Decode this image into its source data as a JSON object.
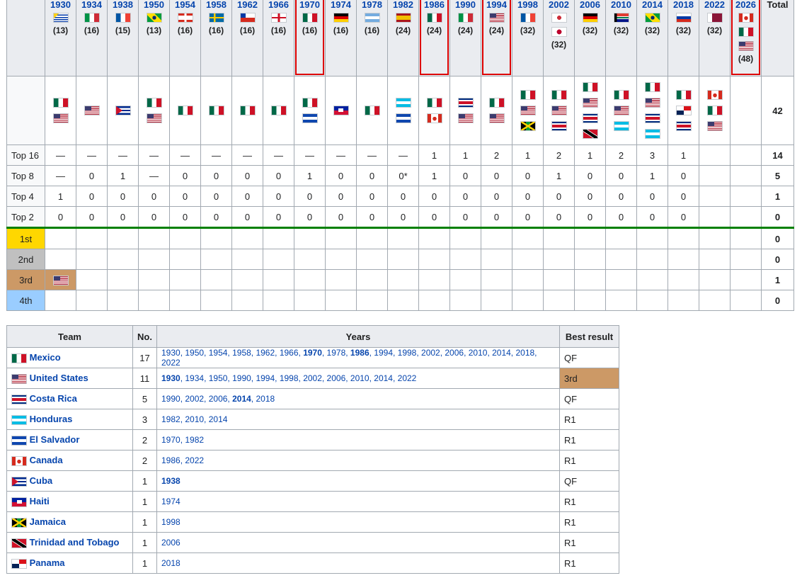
{
  "flag_colors": {
    "MEX": [
      "#006847",
      "#ffffff",
      "#ce1126"
    ],
    "USA": [
      "#b22234",
      "#ffffff",
      "#3c3b6e"
    ],
    "CAN": [
      "#d52b1e",
      "#ffffff",
      "#d52b1e"
    ],
    "CUB": [
      "#002a8f",
      "#ffffff",
      "#cf142b"
    ],
    "HAI": [
      "#00209f",
      "#d21034"
    ],
    "HON": [
      "#00bce4",
      "#ffffff",
      "#00bce4"
    ],
    "SLV": [
      "#0f47af",
      "#ffffff",
      "#0f47af"
    ],
    "CRC": [
      "#002b7f",
      "#ffffff",
      "#ce1126"
    ],
    "JAM": [
      "#009b3a",
      "#fed100",
      "#000000"
    ],
    "TRI": [
      "#ce1126",
      "#000000",
      "#ffffff"
    ],
    "PAN": [
      "#ffffff",
      "#da121a",
      "#072357"
    ]
  },
  "history": {
    "total_label": "Total",
    "years": [
      {
        "year": "1930",
        "count": "(13)",
        "hosts": [
          "URU"
        ],
        "highlight": false
      },
      {
        "year": "1934",
        "count": "(16)",
        "hosts": [
          "ITA"
        ],
        "highlight": false
      },
      {
        "year": "1938",
        "count": "(15)",
        "hosts": [
          "FRA"
        ],
        "highlight": false
      },
      {
        "year": "1950",
        "count": "(13)",
        "hosts": [
          "BRA"
        ],
        "highlight": false
      },
      {
        "year": "1954",
        "count": "(16)",
        "hosts": [
          "SUI"
        ],
        "highlight": false
      },
      {
        "year": "1958",
        "count": "(16)",
        "hosts": [
          "SWE"
        ],
        "highlight": false
      },
      {
        "year": "1962",
        "count": "(16)",
        "hosts": [
          "CHI"
        ],
        "highlight": false
      },
      {
        "year": "1966",
        "count": "(16)",
        "hosts": [
          "ENG"
        ],
        "highlight": false
      },
      {
        "year": "1970",
        "count": "(16)",
        "hosts": [
          "MEX"
        ],
        "highlight": true
      },
      {
        "year": "1974",
        "count": "(16)",
        "hosts": [
          "GER"
        ],
        "highlight": false
      },
      {
        "year": "1978",
        "count": "(16)",
        "hosts": [
          "ARG"
        ],
        "highlight": false
      },
      {
        "year": "1982",
        "count": "(24)",
        "hosts": [
          "ESP"
        ],
        "highlight": false
      },
      {
        "year": "1986",
        "count": "(24)",
        "hosts": [
          "MEX"
        ],
        "highlight": true
      },
      {
        "year": "1990",
        "count": "(24)",
        "hosts": [
          "ITA"
        ],
        "highlight": false
      },
      {
        "year": "1994",
        "count": "(24)",
        "hosts": [
          "USA"
        ],
        "highlight": true
      },
      {
        "year": "1998",
        "count": "(32)",
        "hosts": [
          "FRA"
        ],
        "highlight": false
      },
      {
        "year": "2002",
        "count": "(32)",
        "hosts": [
          "KOR",
          "JPN"
        ],
        "highlight": false
      },
      {
        "year": "2006",
        "count": "(32)",
        "hosts": [
          "GER"
        ],
        "highlight": false
      },
      {
        "year": "2010",
        "count": "(32)",
        "hosts": [
          "RSA"
        ],
        "highlight": false
      },
      {
        "year": "2014",
        "count": "(32)",
        "hosts": [
          "BRA"
        ],
        "highlight": false
      },
      {
        "year": "2018",
        "count": "(32)",
        "hosts": [
          "RUS"
        ],
        "highlight": false
      },
      {
        "year": "2022",
        "count": "(32)",
        "hosts": [
          "QAT"
        ],
        "highlight": false
      },
      {
        "year": "2026",
        "count": "(48)",
        "hosts": [
          "CAN",
          "MEX",
          "USA"
        ],
        "highlight": true
      }
    ],
    "teams_by_year": [
      [
        "MEX",
        "USA"
      ],
      [
        "USA"
      ],
      [
        "CUB"
      ],
      [
        "MEX",
        "USA"
      ],
      [
        "MEX"
      ],
      [
        "MEX"
      ],
      [
        "MEX"
      ],
      [
        "MEX"
      ],
      [
        "MEX",
        "SLV"
      ],
      [
        "HAI"
      ],
      [
        "MEX"
      ],
      [
        "HON",
        "SLV"
      ],
      [
        "MEX",
        "CAN"
      ],
      [
        "CRC",
        "USA"
      ],
      [
        "MEX",
        "USA"
      ],
      [
        "MEX",
        "USA",
        "JAM"
      ],
      [
        "MEX",
        "USA",
        "CRC"
      ],
      [
        "MEX",
        "USA",
        "CRC",
        "TRI"
      ],
      [
        "MEX",
        "USA",
        "HON"
      ],
      [
        "MEX",
        "USA",
        "CRC",
        "HON"
      ],
      [
        "MEX",
        "PAN",
        "CRC"
      ],
      [
        "CAN",
        "MEX",
        "USA"
      ],
      []
    ],
    "teams_total": "42",
    "stats": [
      {
        "label": "Top 16",
        "values": [
          "—",
          "—",
          "—",
          "—",
          "—",
          "—",
          "—",
          "—",
          "—",
          "—",
          "—",
          "—",
          "1",
          "1",
          "2",
          "1",
          "2",
          "1",
          "2",
          "3",
          "1",
          "",
          ""
        ],
        "total": "14"
      },
      {
        "label": "Top 8",
        "values": [
          "—",
          "0",
          "1",
          "—",
          "0",
          "0",
          "0",
          "0",
          "1",
          "0",
          "0",
          "0*",
          "1",
          "0",
          "0",
          "0",
          "1",
          "0",
          "0",
          "1",
          "0",
          "",
          ""
        ],
        "total": "5"
      },
      {
        "label": "Top 4",
        "values": [
          "1",
          "0",
          "0",
          "0",
          "0",
          "0",
          "0",
          "0",
          "0",
          "0",
          "0",
          "0",
          "0",
          "0",
          "0",
          "0",
          "0",
          "0",
          "0",
          "0",
          "0",
          "",
          ""
        ],
        "total": "1"
      },
      {
        "label": "Top 2",
        "values": [
          "0",
          "0",
          "0",
          "0",
          "0",
          "0",
          "0",
          "0",
          "0",
          "0",
          "0",
          "0",
          "0",
          "0",
          "0",
          "0",
          "0",
          "0",
          "0",
          "0",
          "0",
          "",
          ""
        ],
        "total": "0"
      }
    ],
    "places": [
      {
        "label": "1st",
        "cls": "p1",
        "flags": [],
        "total": "0"
      },
      {
        "label": "2nd",
        "cls": "p2",
        "flags": [],
        "total": "0"
      },
      {
        "label": "3rd",
        "cls": "p3",
        "flags": [
          {
            "col": 0,
            "code": "USA"
          }
        ],
        "total": "1"
      },
      {
        "label": "4th",
        "cls": "p4",
        "flags": [],
        "total": "0"
      }
    ]
  },
  "participation": {
    "headers": {
      "team": "Team",
      "no": "No.",
      "years": "Years",
      "best": "Best result"
    },
    "rows": [
      {
        "code": "MEX",
        "team": "Mexico",
        "no": "17",
        "years": [
          {
            "t": "1930, 1950, 1954, 1958, 1962, 1966, ",
            "b": false
          },
          {
            "t": "1970",
            "b": true
          },
          {
            "t": ", 1978, ",
            "b": false
          },
          {
            "t": "1986",
            "b": true
          },
          {
            "t": ", 1994, 1998, 2002, 2006, 2010, 2014, 2018, 2022",
            "b": false
          }
        ],
        "best": "QF",
        "bronze": false
      },
      {
        "code": "USA",
        "team": "United States",
        "no": "11",
        "years": [
          {
            "t": "1930",
            "b": true
          },
          {
            "t": ", 1934, 1950, 1990, 1994, 1998, 2002, 2006, 2010, 2014, 2022",
            "b": false
          }
        ],
        "best": "3rd",
        "bronze": true
      },
      {
        "code": "CRC",
        "team": "Costa Rica",
        "no": "5",
        "years": [
          {
            "t": "1990, 2002, 2006, ",
            "b": false
          },
          {
            "t": "2014",
            "b": true
          },
          {
            "t": ", 2018",
            "b": false
          }
        ],
        "best": "QF",
        "bronze": false
      },
      {
        "code": "HON",
        "team": "Honduras",
        "no": "3",
        "years": [
          {
            "t": "1982, 2010, 2014",
            "b": false
          }
        ],
        "best": "R1",
        "bronze": false
      },
      {
        "code": "SLV",
        "team": "El Salvador",
        "no": "2",
        "years": [
          {
            "t": "1970, 1982",
            "b": false
          }
        ],
        "best": "R1",
        "bronze": false
      },
      {
        "code": "CAN",
        "team": "Canada",
        "no": "2",
        "years": [
          {
            "t": "1986, 2022",
            "b": false
          }
        ],
        "best": "R1",
        "bronze": false
      },
      {
        "code": "CUB",
        "team": "Cuba",
        "no": "1",
        "years": [
          {
            "t": "1938",
            "b": true
          }
        ],
        "best": "QF",
        "bronze": false
      },
      {
        "code": "HAI",
        "team": "Haiti",
        "no": "1",
        "years": [
          {
            "t": "1974",
            "b": false
          }
        ],
        "best": "R1",
        "bronze": false
      },
      {
        "code": "JAM",
        "team": "Jamaica",
        "no": "1",
        "years": [
          {
            "t": "1998",
            "b": false
          }
        ],
        "best": "R1",
        "bronze": false
      },
      {
        "code": "TRI",
        "team": "Trinidad and Tobago",
        "no": "1",
        "years": [
          {
            "t": "2006",
            "b": false
          }
        ],
        "best": "R1",
        "bronze": false
      },
      {
        "code": "PAN",
        "team": "Panama",
        "no": "1",
        "years": [
          {
            "t": "2018",
            "b": false
          }
        ],
        "best": "R1",
        "bronze": false
      }
    ]
  }
}
